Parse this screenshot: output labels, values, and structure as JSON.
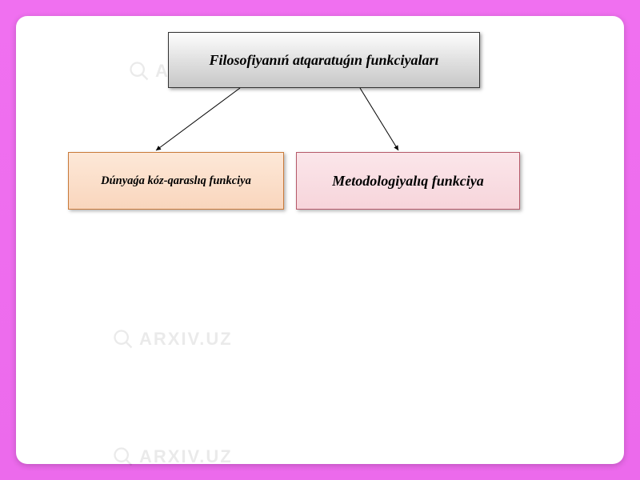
{
  "top_box": "Filosofiyanıń atqaratuǵın funkciyaları",
  "left_box": "Dúnyaǵa kóz-qaraslıq funkciya",
  "right_box": "Metodologiyalıq funkciya",
  "watermark": "ARXIV.UZ",
  "colors": {
    "page_bg": "#ee6dee",
    "slide_bg": "#ffffff",
    "top_fill": "#e1e1e1",
    "left_fill": "#fde0cc",
    "right_fill": "#f9dde2"
  },
  "chart_data": {
    "type": "diagram",
    "root": "Filosofiyanıń atqaratuǵın funkciyaları",
    "children": [
      "Dúnyaǵa kóz-qaraslıq funkciya",
      "Metodologiyalıq funkciya"
    ]
  }
}
